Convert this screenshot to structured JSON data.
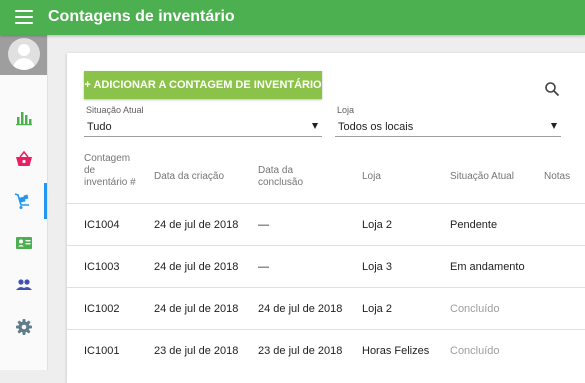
{
  "app": {
    "title": "Contagens de inventário"
  },
  "sidebar": {
    "items": [
      {
        "icon": "bar-chart-icon",
        "color": "#4caf50"
      },
      {
        "icon": "basket-icon",
        "color": "#e91e63"
      },
      {
        "icon": "inventory-cart-icon",
        "color": "#2196f3",
        "active": true
      },
      {
        "icon": "contact-card-icon",
        "color": "#4caf50"
      },
      {
        "icon": "people-icon",
        "color": "#3f51b5"
      },
      {
        "icon": "gear-icon",
        "color": "#607d8b"
      }
    ]
  },
  "toolbar": {
    "add_label": "+ ADICIONAR A CONTAGEM DE INVENTÁRIO"
  },
  "filters": {
    "status": {
      "label": "Situação Atual",
      "value": "Tudo"
    },
    "store": {
      "label": "Loja",
      "value": "Todos os locais"
    }
  },
  "table": {
    "headers": {
      "id": "Contagem de inventário #",
      "created": "Data da criação",
      "completed": "Data da conclusão",
      "store": "Loja",
      "status": "Situação Atual",
      "notes": "Notas"
    },
    "rows": [
      {
        "id": "IC1004",
        "created": "24 de jul de 2018",
        "completed": "—",
        "store": "Loja 2",
        "status": "Pendente"
      },
      {
        "id": "IC1003",
        "created": "24 de jul de 2018",
        "completed": "—",
        "store": "Loja 3",
        "status": "Em andamento"
      },
      {
        "id": "IC1002",
        "created": "24 de jul de 2018",
        "completed": "24 de jul de 2018",
        "store": "Loja 2",
        "status": "Concluído"
      },
      {
        "id": "IC1001",
        "created": "23 de jul de 2018",
        "completed": "23 de jul de 2018",
        "store": "Horas Felizes",
        "status": "Concluído"
      }
    ]
  },
  "colors": {
    "header": "#4caf50",
    "add_button": "#8bc34a",
    "active_nav": "#2196f3"
  }
}
